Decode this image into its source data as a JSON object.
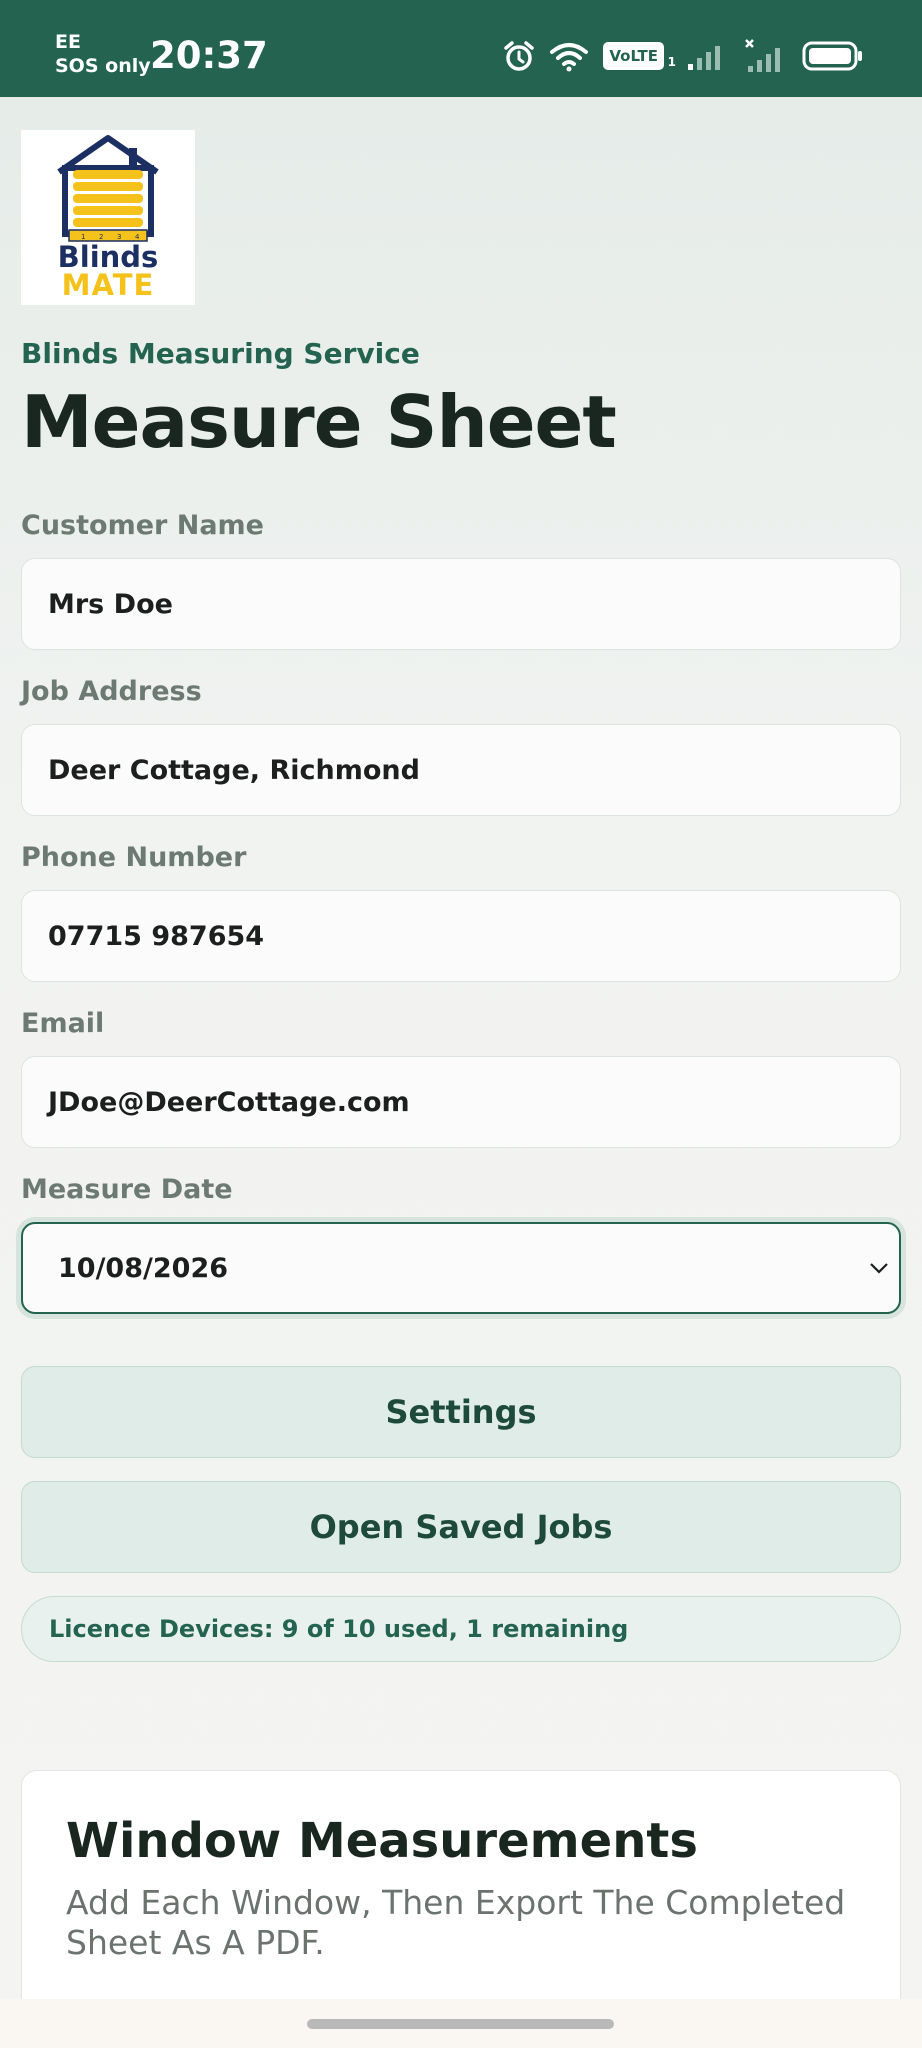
{
  "status_bar": {
    "carrier_line1": "EE",
    "carrier_line2": "SOS only",
    "time": "20:37",
    "volte": "VoLTE",
    "volte_sim": "1",
    "icons": [
      "alarm-icon",
      "wifi-icon",
      "volte-icon",
      "signal-icon",
      "no-signal-icon",
      "battery-icon"
    ]
  },
  "logo": {
    "line1": "Blinds",
    "line2": "MATE",
    "ruler": [
      "1",
      "2",
      "3",
      "4"
    ]
  },
  "header": {
    "subtitle": "Blinds Measuring Service",
    "title": "Measure Sheet"
  },
  "form": {
    "customer_name": {
      "label": "Customer Name",
      "value": "Mrs Doe"
    },
    "job_address": {
      "label": "Job Address",
      "value": "Deer Cottage, Richmond"
    },
    "phone": {
      "label": "Phone Number",
      "value": "07715 987654"
    },
    "email": {
      "label": "Email",
      "value": "JDoe@DeerCottage.com"
    },
    "measure_date": {
      "label": "Measure Date",
      "value": "10/08/2026"
    }
  },
  "buttons": {
    "settings": "Settings",
    "open_saved_jobs": "Open Saved Jobs"
  },
  "licence": "Licence Devices: 9 of 10 used, 1 remaining",
  "window_card": {
    "title": "Window Measurements",
    "subtitle": "Add Each Window, Then Export The Completed Sheet As A PDF."
  },
  "colors": {
    "brand_green": "#23634f",
    "logo_navy": "#1b2f63",
    "logo_yellow": "#f4c21b"
  }
}
